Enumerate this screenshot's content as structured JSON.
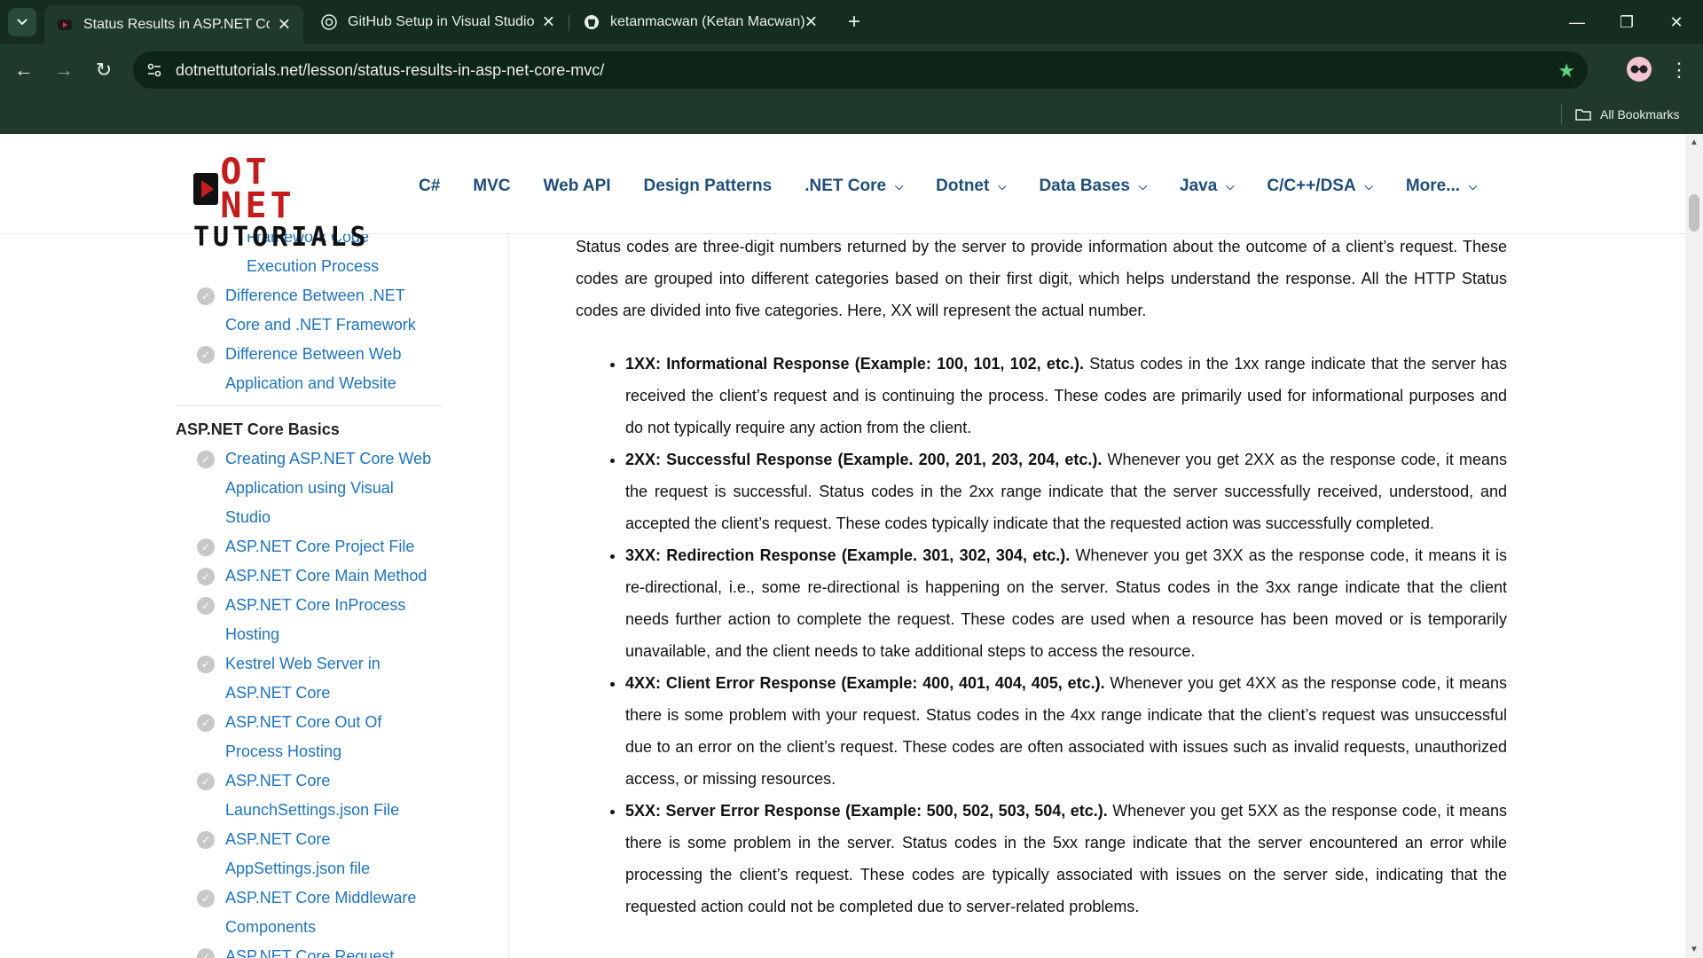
{
  "browser": {
    "tabs": [
      {
        "title": "Status Results in ASP.NET Core",
        "active": true
      },
      {
        "title": "GitHub Setup in Visual Studio",
        "active": false
      },
      {
        "title": "ketanmacwan (Ketan Macwan)",
        "active": false
      }
    ],
    "url": "dotnettutorials.net/lesson/status-results-in-asp-net-core-mvc/",
    "bookmarks_label": "All Bookmarks",
    "accent": "#5fd17d"
  },
  "site": {
    "logo": {
      "line1": "OT NET",
      "line2": "TUTORIALS"
    },
    "nav": [
      {
        "label": "C#",
        "dropdown": false
      },
      {
        "label": "MVC",
        "dropdown": false
      },
      {
        "label": "Web API",
        "dropdown": false
      },
      {
        "label": "Design Patterns",
        "dropdown": false
      },
      {
        "label": ".NET Core",
        "dropdown": true
      },
      {
        "label": "Dotnet",
        "dropdown": true
      },
      {
        "label": "Data Bases",
        "dropdown": true
      },
      {
        "label": "Java",
        "dropdown": true
      },
      {
        "label": "C/C++/DSA",
        "dropdown": true
      },
      {
        "label": "More...",
        "dropdown": true
      }
    ]
  },
  "sidebar": {
    "top_items": [
      {
        "label": "Framework Code Execution Process"
      },
      {
        "label": "Difference Between .NET Core and .NET Framework"
      },
      {
        "label": "Difference Between Web Application and Website"
      }
    ],
    "section_heading": "ASP.NET Core Basics",
    "items": [
      {
        "label": "Creating ASP.NET Core Web Application using Visual Studio"
      },
      {
        "label": "ASP.NET Core Project File"
      },
      {
        "label": "ASP.NET Core Main Method"
      },
      {
        "label": "ASP.NET Core InProcess Hosting"
      },
      {
        "label": "Kestrel Web Server in ASP.NET Core"
      },
      {
        "label": "ASP.NET Core Out Of Process Hosting"
      },
      {
        "label": "ASP.NET Core LaunchSettings.json File"
      },
      {
        "label": "ASP.NET Core AppSettings.json file"
      },
      {
        "label": "ASP.NET Core Middleware Components"
      },
      {
        "label": "ASP.NET Core Request"
      }
    ]
  },
  "article": {
    "intro": "Status codes are three-digit numbers returned by the server to provide information about the outcome of a client’s request. These codes are grouped into different categories based on their first digit, which helps understand the response. All the HTTP Status codes are divided into five categories. Here, XX will represent the actual number.",
    "list": [
      {
        "bold": "1XX: Informational Response (Example: 100, 101, 102, etc.).",
        "text": " Status codes in the 1xx range indicate that the server has received the client’s request and is continuing the process. These codes are primarily used for informational purposes and do not typically require any action from the client."
      },
      {
        "bold": "2XX: Successful Response (Example. 200, 201, 203, 204, etc.).",
        "text": " Whenever you get 2XX as the response code, it means the request is successful. Status codes in the 2xx range indicate that the server successfully received, understood, and accepted the client’s request. These codes typically indicate that the requested action was successfully completed."
      },
      {
        "bold": "3XX: Redirection Response (Example. 301, 302, 304, etc.).",
        "text": " Whenever you get 3XX as the response code, it means it is re-directional, i.e., some re-directional is happening on the server. Status codes in the 3xx range indicate that the client needs further action to complete the request. These codes are used when a resource has been moved or is temporarily unavailable, and the client needs to take additional steps to access the resource."
      },
      {
        "bold": "4XX: Client Error Response (Example: 400, 401, 404, 405, etc.).",
        "text": " Whenever you get 4XX as the response code, it means there is some problem with your request. Status codes in the 4xx range indicate that the client’s request was unsuccessful due to an error on the client’s request. These codes are often associated with issues such as invalid requests, unauthorized access, or missing resources."
      },
      {
        "bold": "5XX: Server Error Response (Example: 500, 502, 503, 504, etc.).",
        "text": " Whenever you get 5XX as the response code, it means there is some problem in the server. Status codes in the 5xx range indicate that the server encountered an error while processing the client’s request. These codes are typically associated with issues on the server side, indicating that the requested action could not be completed due to server-related problems."
      }
    ]
  }
}
